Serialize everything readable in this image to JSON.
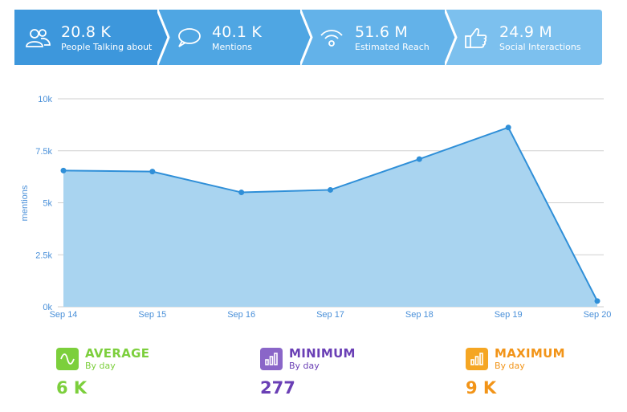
{
  "kpis": [
    {
      "value": "20.8 K",
      "label": "People Talking about",
      "icon": "people-icon"
    },
    {
      "value": "40.1 K",
      "label": "Mentions",
      "icon": "speech-bubble-icon"
    },
    {
      "value": "51.6 M",
      "label": "Estimated Reach",
      "icon": "broadcast-icon"
    },
    {
      "value": "24.9 M",
      "label": "Social Interactions",
      "icon": "thumbs-up-icon"
    }
  ],
  "colors": {
    "kpi_1": "#3d97dc",
    "kpi_2": "#4fa6e3",
    "kpi_3": "#63b2e9",
    "kpi_4": "#7cc0ee",
    "area_fill": "#a9d4f0",
    "line": "#2f8fd8",
    "grid": "#cfcfcf",
    "axis_text": "#4a90d9",
    "average": "#7ccf3c",
    "minimum": "#6a3fb5",
    "maximum": "#f29418"
  },
  "chart_data": {
    "type": "area",
    "categories": [
      "Sep 14",
      "Sep 15",
      "Sep 16",
      "Sep 17",
      "Sep 18",
      "Sep 19",
      "Sep 20"
    ],
    "series": [
      {
        "values": [
          6550,
          6500,
          5500,
          5620,
          7100,
          8620,
          277
        ]
      }
    ],
    "ylabel": "mentions",
    "xlabel": "",
    "ylim": [
      0,
      10000
    ],
    "yticks": [
      0,
      2500,
      5000,
      7500,
      10000
    ],
    "ytick_labels": [
      "0k",
      "2.5k",
      "5k",
      "7.5k",
      "10k"
    ],
    "grid": true,
    "legend": "none"
  },
  "summary": [
    {
      "title": "AVERAGE",
      "sub": "By day",
      "value": "6 K",
      "icon": "wave-icon",
      "color": "#7ccf3c"
    },
    {
      "title": "MINIMUM",
      "sub": "By day",
      "value": "277",
      "icon": "bar-chart-icon",
      "color": "#6a3fb5"
    },
    {
      "title": "MAXIMUM",
      "sub": "By day",
      "value": "9 K",
      "icon": "bar-chart-icon",
      "color": "#f29418"
    }
  ]
}
